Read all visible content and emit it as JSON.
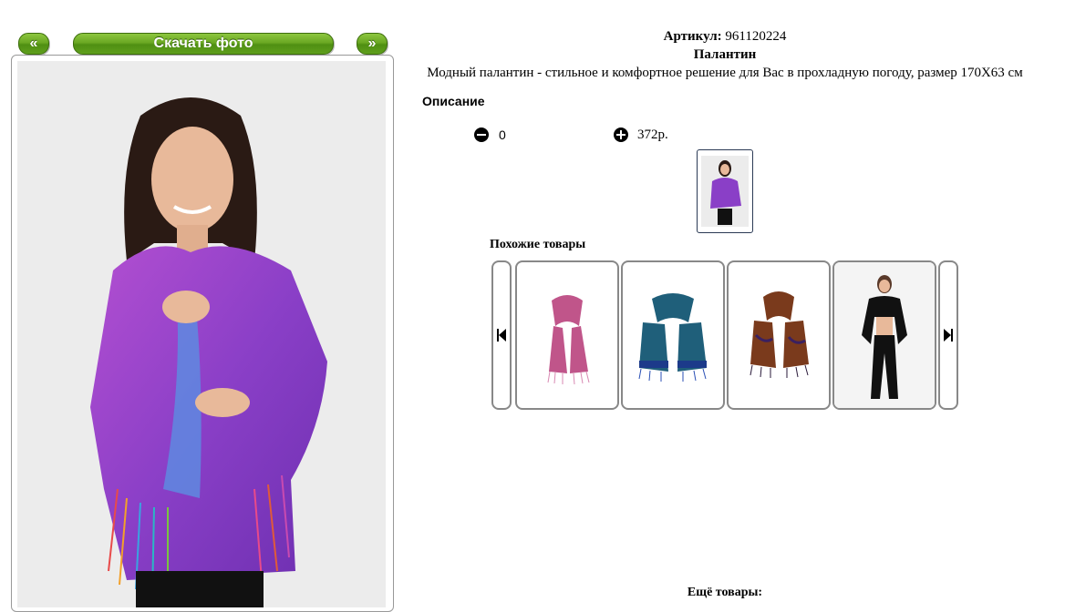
{
  "gallery": {
    "prev_label": "«",
    "download_label": "Скачать фото",
    "next_label": "»"
  },
  "product": {
    "article_label": "Артикул:",
    "article_value": "961120224",
    "name": "Палантин",
    "description_text": "Модный палантин - стильное и комфортное решение для Вас в прохладную погоду, размер 170X63 см",
    "description_heading": "Описание",
    "quantity": "0",
    "price": "372р."
  },
  "related": {
    "heading": "Похожие товары",
    "items": [
      {
        "color": "#c0558a",
        "kind": "scarf"
      },
      {
        "color": "#1f5f7a",
        "kind": "scarf"
      },
      {
        "color": "#7a3a1c",
        "kind": "scarf"
      },
      {
        "color": "#111111",
        "kind": "model"
      }
    ]
  },
  "more": {
    "heading": "Ещё товары:"
  },
  "colors": {
    "accent_green": "#6aa823",
    "scarf_main": "#8a3fc7"
  }
}
